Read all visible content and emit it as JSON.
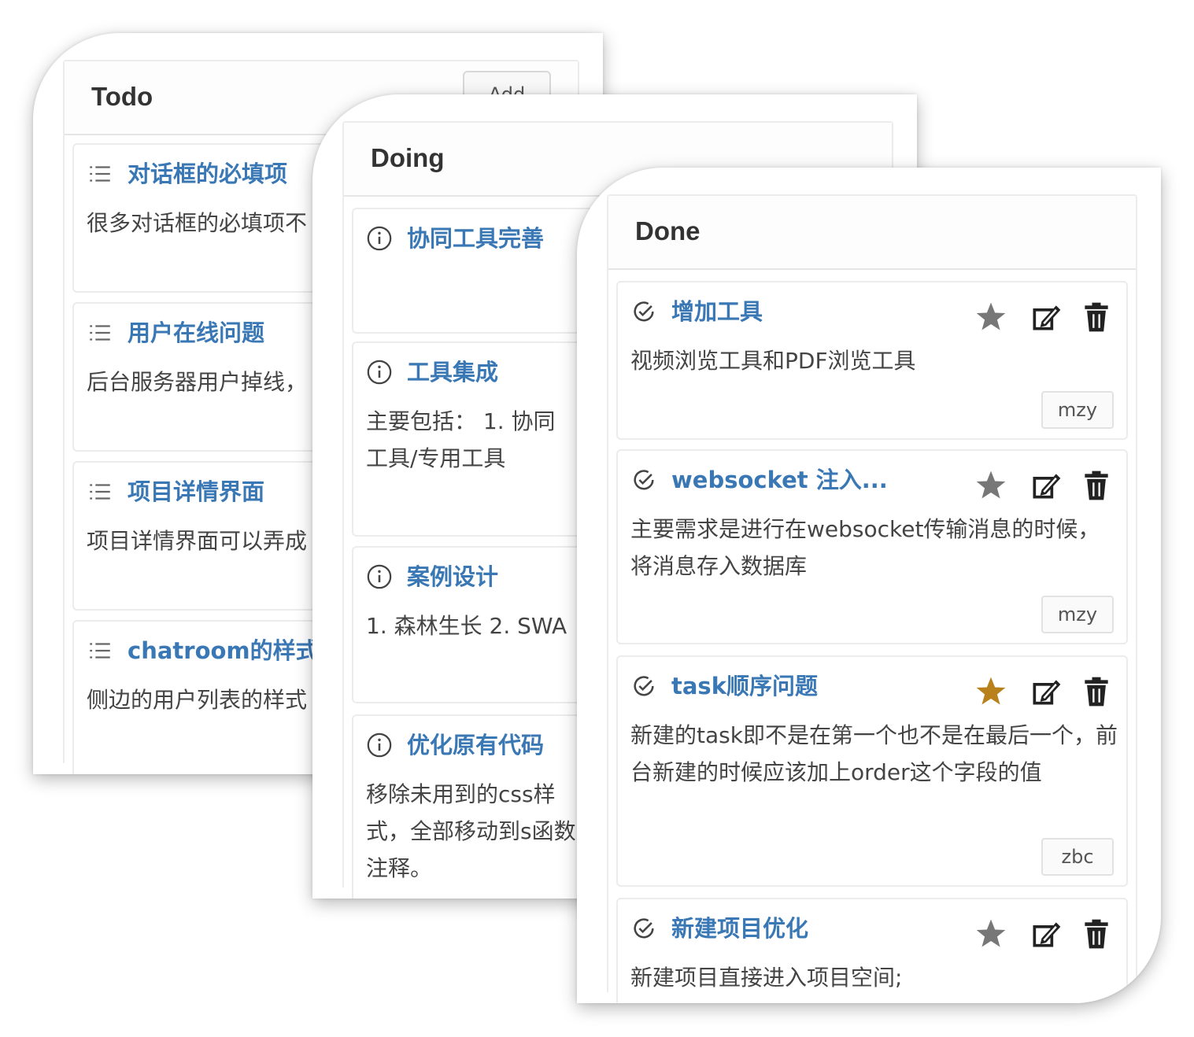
{
  "columns": {
    "todo": {
      "title": "Todo",
      "add_label": "Add",
      "cards": [
        {
          "title": "对话框的必填项",
          "desc": "很多对话框的必填项不"
        },
        {
          "title": "用户在线问题",
          "desc": "后台服务器用户掉线，"
        },
        {
          "title": "项目详情界面",
          "desc": "项目详情界面可以弄成"
        },
        {
          "title": "chatroom的样式",
          "desc": "侧边的用户列表的样式"
        }
      ]
    },
    "doing": {
      "title": "Doing",
      "cards": [
        {
          "title": "协同工具完善",
          "desc": ""
        },
        {
          "title": "工具集成",
          "desc": "主要包括： 1. 协同工具/专用工具"
        },
        {
          "title": "案例设计",
          "desc": "1. 森林生长 2. SWA"
        },
        {
          "title": "优化原有代码",
          "desc": "移除未用到的css样式，全部移动到s函数注释。"
        }
      ]
    },
    "done": {
      "title": "Done",
      "cards": [
        {
          "title": "增加工具",
          "desc": "视频浏览工具和PDF浏览工具",
          "assignee": "mzy",
          "starred": false
        },
        {
          "title": "websocket 注入...",
          "desc": "主要需求是进行在websocket传输消息的时候，将消息存入数据库",
          "assignee": "mzy",
          "starred": false
        },
        {
          "title": "task顺序问题",
          "desc": "新建的task即不是在第一个也不是在最后一个，前台新建的时候应该加上order这个字段的值",
          "assignee": "zbc",
          "starred": true
        },
        {
          "title": "新建项目优化",
          "desc": "新建项目直接进入项目空间;",
          "assignee": "",
          "starred": false
        }
      ]
    }
  },
  "icons": {
    "todo_card": "list-icon",
    "doing_card": "info-circle-icon",
    "done_card": "check-circle-icon",
    "card_actions": [
      "star-icon",
      "edit-icon",
      "trash-icon"
    ]
  },
  "colors": {
    "card_title": "#3a78b5",
    "star_inactive": "#777777",
    "star_active": "#b8811c",
    "text": "#444444"
  }
}
